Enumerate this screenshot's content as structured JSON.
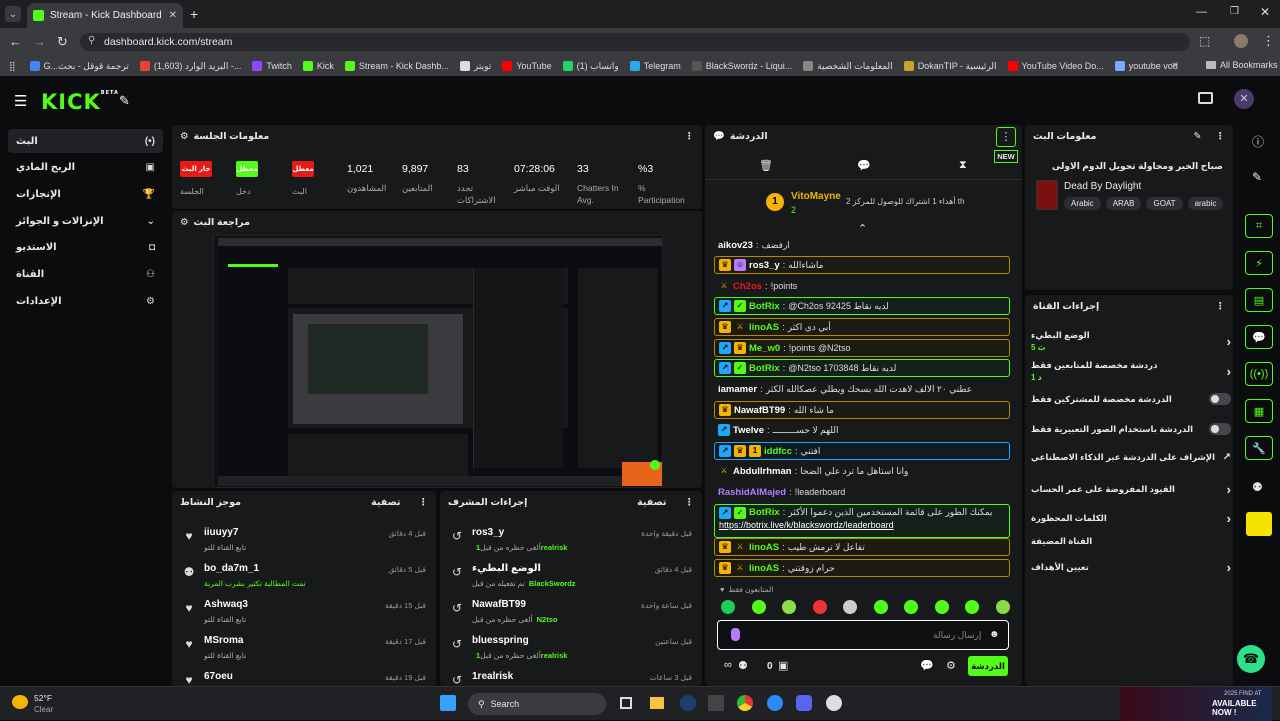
{
  "browser": {
    "tab_title": "Stream - Kick Dashboard",
    "url": "dashboard.kick.com/stream",
    "bookmarks": [
      "G...ترجمة قوقل - بحث",
      "(1,603) البريد الوارد -...",
      "Twitch",
      "Kick",
      "Stream - Kick Dashb...",
      "تويتر",
      "YouTube",
      "واتساب (1)",
      "Telegram",
      "BlackSwordz - Liqui...",
      "المعلومات الشخصية",
      "DokanTIP - الرئيسية",
      "YouTube Video Do...",
      "youtube vod"
    ],
    "all_bookmarks": "All Bookmarks"
  },
  "kick": {
    "logo": "KICK",
    "beta": "BETA"
  },
  "sidebar": {
    "items": [
      {
        "label": "البث",
        "icon": "(•)"
      },
      {
        "label": "الربح المادي",
        "icon": "▣"
      },
      {
        "label": "الإنجازات",
        "icon": "🏆"
      },
      {
        "label": "الإنزالات و الجوائز",
        "icon": ""
      },
      {
        "label": "الاستديو",
        "icon": "◘"
      },
      {
        "label": "القناة",
        "icon": "⚇"
      },
      {
        "label": "الإعدادات",
        "icon": "⚙"
      }
    ]
  },
  "session": {
    "title": "معلومات الجلسة",
    "toggles": [
      {
        "btn": "جار البث",
        "label": "الجلسة",
        "color": "#e91916"
      },
      {
        "btn": "معطل",
        "label": "دخل",
        "color": "#53fc18"
      },
      {
        "btn": "معطل",
        "label": "البث",
        "color": "#e91916"
      }
    ],
    "stats": [
      {
        "value": "1,021",
        "label": "المشاهدون"
      },
      {
        "value": "9,897",
        "label": "المتابعين"
      },
      {
        "value": "83",
        "label": "تجدد الاشتراكات"
      },
      {
        "value": "07:28:06",
        "label": "الوقت مباشر"
      },
      {
        "value": "33",
        "label": "Chatters In Avg."
      },
      {
        "value": "%3",
        "label": "% Participation"
      }
    ]
  },
  "preview": {
    "title": "مراجعة البث"
  },
  "activity": {
    "title": "موجز النشاط",
    "filter": "تصفية",
    "rows": [
      {
        "name": "iiuuyy7",
        "sub": "تابع القناة للتو",
        "time": "قبل 4 دقائق",
        "icon": "♥"
      },
      {
        "name": "bo_da7m_1",
        "sub": "تمت المطالبة تكثير بشرب المربة",
        "time": "قبل 5 دقائق",
        "icon": "⚉"
      },
      {
        "name": "Ashwaq3",
        "sub": "تابع القناة للتو",
        "time": "قبل 15 دقيقة",
        "icon": "♥"
      },
      {
        "name": "MSroma",
        "sub": "تابع القناة للتو",
        "time": "قبل 17 دقيقة",
        "icon": "♥"
      },
      {
        "name": "67oeu",
        "sub": "",
        "time": "قبل 19 دقيقة",
        "icon": "♥"
      }
    ]
  },
  "modactions": {
    "title": "إجراءات المشرف",
    "filter": "تصفية",
    "rows": [
      {
        "name": "ros3_y",
        "sub": "ألغى حظره من قبل",
        "by": "1realrisk",
        "time": "قبل دقيقة واحدة",
        "icon": "↺"
      },
      {
        "name": "الوضع البطيء",
        "sub": "تم تفعيله من قبل",
        "by": "BlackSwordz",
        "time": "قبل 4 دقائق",
        "icon": "↺"
      },
      {
        "name": "NawafBT99",
        "sub": "ألغى حظره من قبل",
        "by": "N2tso",
        "time": "قبل ساعة واحدة",
        "icon": "↺"
      },
      {
        "name": "bluesspring",
        "sub": "ألغى حظره من قبل",
        "by": "1realrisk",
        "time": "قبل ساعتين",
        "icon": "↺"
      },
      {
        "name": "1realrisk",
        "sub": "",
        "by": "",
        "time": "قبل 3 ساعات",
        "icon": "↺"
      }
    ]
  },
  "chat": {
    "title": "الدردشة",
    "new_badge": "NEW",
    "pinned": {
      "user": "VitoMayne",
      "count": "2",
      "text": "أهداء 1 اشتراك للوصول للمركز 2 th"
    },
    "messages": [
      {
        "user": "aikov23",
        "text": "ارفضف",
        "color": "#ffffff",
        "style": "plain",
        "badges": []
      },
      {
        "user": "ros3_y",
        "text": "ماشاءالله",
        "color": "#ffffff",
        "style": "hl",
        "badges": [
          "crown",
          "mod"
        ]
      },
      {
        "user": "Ch2os",
        "text": "!points",
        "color": "#e91916",
        "style": "plain",
        "badges": [
          "sword"
        ]
      },
      {
        "user": "BotRix",
        "text": "@Ch2os 92425 لديه نقاط",
        "color": "#53fc18",
        "style": "bot",
        "badges": [
          "bot",
          "verified"
        ]
      },
      {
        "user": "linoAS",
        "text": "أبي دي اكثر",
        "color": "#53fc18",
        "style": "hl",
        "badges": [
          "crown",
          "sword"
        ]
      },
      {
        "user": "Me_w0",
        "text": "!points @N2tso",
        "color": "#53fc18",
        "style": "hl",
        "badges": [
          "bot",
          "crown"
        ]
      },
      {
        "user": "BotRix",
        "text": "@N2tso 1703848 لديه نقاط",
        "color": "#53fc18",
        "style": "bot",
        "badges": [
          "bot",
          "verified"
        ]
      },
      {
        "user": "iamamer",
        "text": "عطني ٢٠ الالف لاهدت الله بسحك ويطلي عصكالله الكثر",
        "color": "#ffffff",
        "style": "plain",
        "badges": []
      },
      {
        "user": "NawafBT99",
        "text": "ما شاء الله",
        "color": "#ffffff",
        "style": "hl",
        "badges": [
          "crown"
        ]
      },
      {
        "user": "Twelve",
        "text": "اللهم لا حســـــــــ",
        "color": "#ffffff",
        "style": "plain",
        "badges": [
          "bot"
        ]
      },
      {
        "user": "iddfcc",
        "text": "افتني",
        "color": "#53fc18",
        "style": "hl2",
        "badges": [
          "bot",
          "crown",
          "gold"
        ]
      },
      {
        "user": "Abdullrhman",
        "text": "وانا استاهل ما ترد علي الضحا",
        "color": "#ffffff",
        "style": "plain",
        "badges": [
          "sword"
        ]
      },
      {
        "user": "RashidAlMajed",
        "text": "!leaderboard",
        "color": "#b57cff",
        "style": "plain",
        "badges": []
      },
      {
        "user": "BotRix",
        "text": "يمكنك الطور على قائمة المستخدمين الذين دعموا الأكثر",
        "link": "https://botrix.live/k/blackswordz/leaderboard",
        "color": "#53fc18",
        "style": "bot2",
        "badges": [
          "bot",
          "verified"
        ]
      },
      {
        "user": "linoAS",
        "text": "تفاعل لا ترمش طيب",
        "color": "#53fc18",
        "style": "hl",
        "badges": [
          "crown",
          "sword"
        ]
      },
      {
        "user": "linoAS",
        "text": "حرام زوقتني",
        "color": "#53fc18",
        "style": "hl",
        "badges": [
          "crown",
          "sword"
        ]
      }
    ],
    "followers_only": "المتابعون فقط",
    "input_placeholder": "إرسال رسالة",
    "points": "0",
    "send": "الدردشة"
  },
  "streaminfo": {
    "title": "معلومات البث",
    "stream_title": "صباح الخير ومحاولة تحويل الدوم الاولى",
    "game": "Dead By Daylight",
    "tags": [
      "Arabic",
      "ARAB",
      "GOAT",
      "arabic"
    ]
  },
  "channelactions": {
    "title": "إجراءات القناة",
    "rows": [
      {
        "label": "الوضع البطيء",
        "sub": "5 ث",
        "kind": "chev"
      },
      {
        "label": "دردشة مخصصة للمتابعين فقط",
        "sub": "1 د",
        "kind": "chev"
      },
      {
        "label": "الدردشة مخصصة للمشتركين فقط",
        "sub": "",
        "kind": "switch"
      },
      {
        "label": "الدردشة باستخدام الصور التعبيرية فقط",
        "sub": "",
        "kind": "switch"
      },
      {
        "label": "الإشراف على الدردشة عبر الذكاء الاصطناعي",
        "sub": "",
        "kind": "ext"
      },
      {
        "label": "القيود المفروضة على عمر الحساب",
        "sub": "",
        "kind": "chev"
      },
      {
        "label": "الكلمات المحظورة",
        "sub": "",
        "kind": "chev"
      },
      {
        "label": "القناة المضيفة",
        "sub": "",
        "kind": "none"
      },
      {
        "label": "تعيين الأهداف",
        "sub": "",
        "kind": "chev"
      }
    ]
  },
  "taskbar": {
    "temp": "52°F",
    "weather": "Clear",
    "search": "Search"
  },
  "ad": {
    "text": "2025 FIND AT",
    "cta": "AVAILABLE NOW !"
  }
}
